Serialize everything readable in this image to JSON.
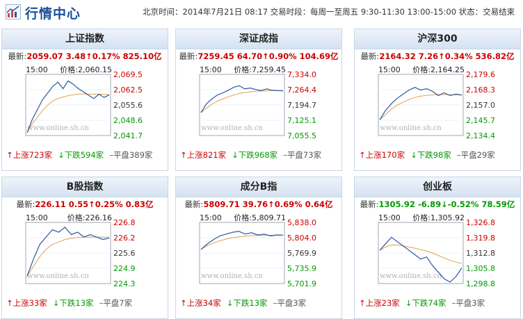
{
  "header": {
    "title": "行情中心",
    "info": "北京时间：2014年7月21日 08:17 交易时段：每周一至周五 9:30-11:30 13:00-15:00 状态：交易结束"
  },
  "colors": {
    "up": "#cc0000",
    "down": "#009900",
    "line": "#2a57a3",
    "avg": "#e0a050"
  },
  "panels": [
    {
      "name": "上证指数",
      "quote": {
        "label": "最新:",
        "value": "2059.07",
        "change": "3.48",
        "arrow": "↑",
        "pct": "0.17%",
        "amount": "825.10亿",
        "dir": "up"
      },
      "chart": {
        "time": "15:00",
        "price_label": "价格:2,060.15",
        "ticks": [
          "2,069.5",
          "2,062.5",
          "2,055.6",
          "2,048.6",
          "2,041.7"
        ],
        "watermark": "www.online.sh.cn",
        "price_series": [
          2043.0,
          2049.0,
          2053.5,
          2058.0,
          2061.0,
          2064.0,
          2066.0,
          2063.0,
          2066.5,
          2065.0,
          2063.0,
          2061.5,
          2060.0,
          2058.5,
          2060.5,
          2059.0,
          2060.15
        ],
        "avg_series": [
          2043.0,
          2047.0,
          2050.0,
          2053.0,
          2055.5,
          2057.5,
          2058.5,
          2059.2,
          2059.8,
          2060.2,
          2060.5,
          2060.6,
          2060.6,
          2060.5,
          2060.5,
          2060.4,
          2060.3
        ]
      },
      "stats": {
        "up": "上涨723家",
        "down": "下跌594家",
        "flat": "平盘389家"
      }
    },
    {
      "name": "深证成指",
      "quote": {
        "label": "最新:",
        "value": "7259.45",
        "change": "64.70",
        "arrow": "↑",
        "pct": "0.90%",
        "amount": "104.69亿",
        "dir": "up"
      },
      "chart": {
        "time": "15:00",
        "price_label": "价格:7,259.45",
        "ticks": [
          "7,334.0",
          "7,264.4",
          "7,194.7",
          "7,125.1",
          "7,055.5"
        ],
        "watermark": "www.online.sh.cn",
        "price_series": [
          7160,
          7200,
          7222,
          7240,
          7250,
          7262,
          7275,
          7282,
          7268,
          7272,
          7265,
          7260,
          7268,
          7262,
          7260,
          7259.45
        ],
        "avg_series": [
          7160,
          7180,
          7198,
          7212,
          7222,
          7232,
          7240,
          7247,
          7251,
          7255,
          7257,
          7258,
          7259,
          7260,
          7260,
          7260
        ]
      },
      "stats": {
        "up": "上涨821家",
        "down": "下跌968家",
        "flat": "平盘73家"
      }
    },
    {
      "name": "沪深300",
      "quote": {
        "label": "最新:",
        "value": "2164.32",
        "change": "7.26",
        "arrow": "↑",
        "pct": "0.34%",
        "amount": "536.82亿",
        "dir": "up"
      },
      "chart": {
        "time": "15:00",
        "price_label": "价格:2,164.25",
        "ticks": [
          "2,179.6",
          "2,168.3",
          "2,157.0",
          "2,145.7",
          "2,134.4"
        ],
        "watermark": "www.online.sh.cn",
        "price_series": [
          2146,
          2153,
          2158,
          2162,
          2165,
          2168,
          2170,
          2168,
          2169,
          2167,
          2164,
          2166,
          2164,
          2165,
          2164.25
        ],
        "avg_series": [
          2146,
          2150,
          2154,
          2157,
          2159,
          2161,
          2162.5,
          2163.5,
          2164,
          2164.5,
          2164.6,
          2164.6,
          2164.6,
          2164.5,
          2164.5
        ]
      },
      "stats": {
        "up": "上涨170家",
        "down": "下跌98家",
        "flat": "平盘29家"
      }
    },
    {
      "name": "B股指数",
      "quote": {
        "label": "最新:",
        "value": "226.11",
        "change": "0.55",
        "arrow": "↑",
        "pct": "0.25%",
        "amount": "0.83亿",
        "dir": "up"
      },
      "chart": {
        "time": "15:00",
        "price_label": "价格:226.16",
        "ticks": [
          "226.8",
          "226.2",
          "225.6",
          "224.9",
          "224.3"
        ],
        "watermark": "www.online.sh.cn",
        "price_series": [
          224.6,
          225.3,
          225.9,
          226.2,
          226.5,
          226.4,
          226.6,
          226.3,
          226.4,
          226.2,
          226.3,
          226.2,
          226.1,
          226.16
        ],
        "avg_series": [
          224.6,
          225.0,
          225.4,
          225.7,
          225.9,
          226.0,
          226.1,
          226.15,
          226.18,
          226.2,
          226.2,
          226.2,
          226.2,
          226.2
        ]
      },
      "stats": {
        "up": "上涨33家",
        "down": "下跌13家",
        "flat": "平盘7家"
      }
    },
    {
      "name": "成分B指",
      "quote": {
        "label": "最新:",
        "value": "5809.71",
        "change": "39.76",
        "arrow": "↑",
        "pct": "0.69%",
        "amount": "0.64亿",
        "dir": "up"
      },
      "chart": {
        "time": "15:00",
        "price_label": "价格:5,809.71",
        "ticks": [
          "5,838.0",
          "5,804.0",
          "5,769.9",
          "5,735.9",
          "5,701.9"
        ],
        "watermark": "www.online.sh.cn",
        "price_series": [
          5778,
          5790,
          5800,
          5808,
          5812,
          5816,
          5818,
          5812,
          5815,
          5810,
          5812,
          5808,
          5810,
          5809.71
        ],
        "avg_series": [
          5778,
          5786,
          5792,
          5797,
          5801,
          5804,
          5806,
          5807.5,
          5808.5,
          5809,
          5809.3,
          5809.4,
          5809.5,
          5809.5
        ]
      },
      "stats": {
        "up": "上涨34家",
        "down": "下跌13家",
        "flat": "平盘3家"
      }
    },
    {
      "name": "创业板",
      "quote": {
        "label": "最新:",
        "value": "1305.92",
        "change": "-6.89",
        "arrow": "↓",
        "pct": "-0.52%",
        "amount": "78.59亿",
        "dir": "down"
      },
      "chart": {
        "time": "15:00",
        "price_label": "价格:1,305.92",
        "ticks": [
          "1,326.8",
          "1,319.8",
          "1,312.8",
          "1,305.8",
          "1,298.8"
        ],
        "watermark": "www.online.sh.cn",
        "price_series": [
          1314,
          1317,
          1320,
          1318,
          1316,
          1314,
          1312,
          1310,
          1311,
          1307,
          1304,
          1301,
          1299.5,
          1302,
          1305.92
        ],
        "avg_series": [
          1314,
          1315.5,
          1316.5,
          1316.5,
          1316,
          1315.5,
          1315,
          1314.3,
          1313.7,
          1312.8,
          1311.7,
          1310.5,
          1309.4,
          1308.6,
          1308
        ]
      },
      "stats": {
        "up": "上涨23家",
        "down": "下跌74家",
        "flat": "平盘3家"
      }
    }
  ]
}
